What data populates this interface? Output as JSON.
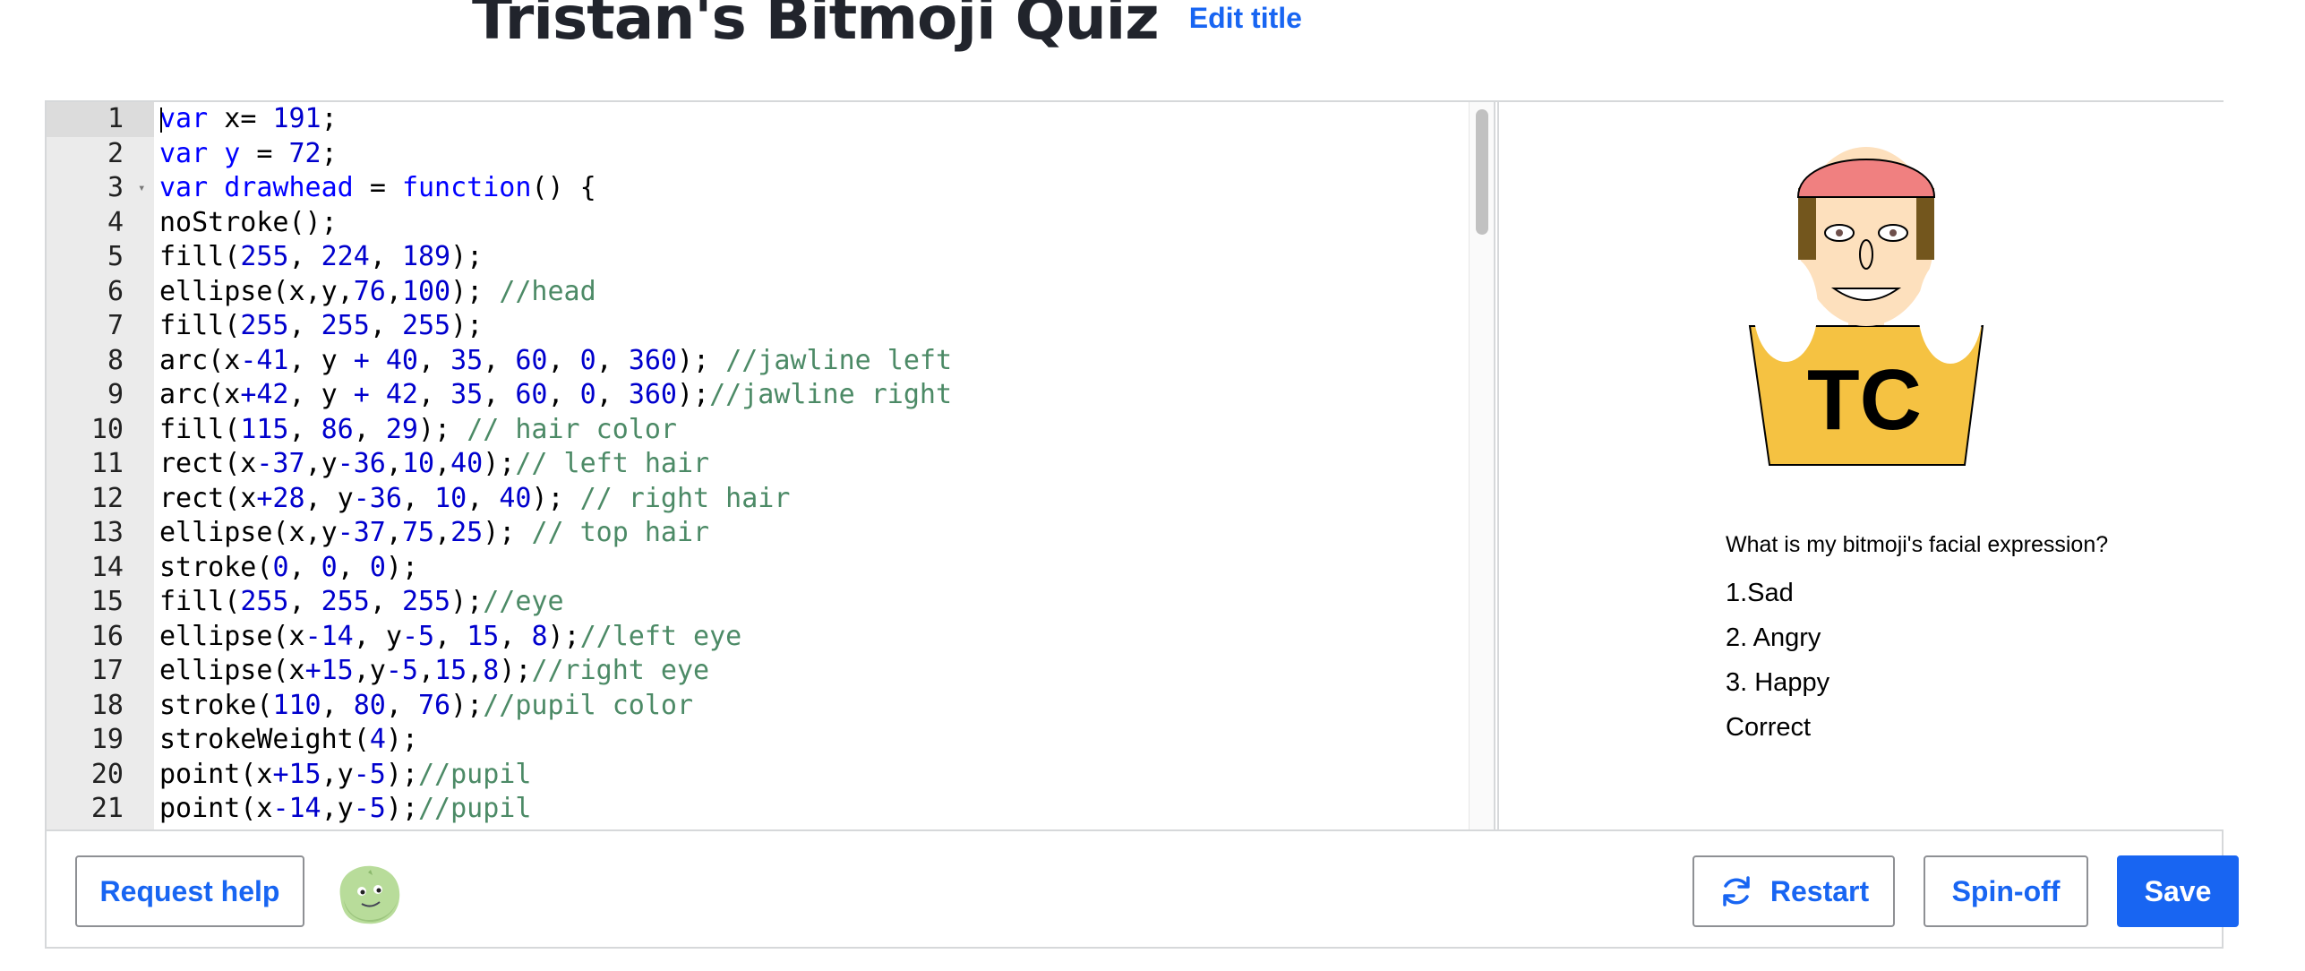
{
  "header": {
    "title": "Tristan's Bitmoji Quiz",
    "edit_title_label": "Edit title"
  },
  "editor": {
    "lines": [
      {
        "num": "1",
        "tokens": [
          {
            "t": "var",
            "c": "k"
          },
          {
            "t": " x",
            "c": "p"
          },
          {
            "t": "=",
            "c": "p"
          },
          {
            "t": " ",
            "c": "p"
          },
          {
            "t": "191",
            "c": "n"
          },
          {
            "t": ";",
            "c": "p"
          }
        ]
      },
      {
        "num": "2",
        "tokens": [
          {
            "t": "var",
            "c": "k"
          },
          {
            "t": " y ",
            "c": "k"
          },
          {
            "t": "=",
            "c": "p"
          },
          {
            "t": " ",
            "c": "p"
          },
          {
            "t": "72",
            "c": "n"
          },
          {
            "t": ";",
            "c": "p"
          }
        ]
      },
      {
        "num": "3",
        "tokens": [
          {
            "t": "var",
            "c": "k"
          },
          {
            "t": " drawhead ",
            "c": "k"
          },
          {
            "t": "=",
            "c": "p"
          },
          {
            "t": " ",
            "c": "p"
          },
          {
            "t": "function",
            "c": "k"
          },
          {
            "t": "() {",
            "c": "p"
          }
        ]
      },
      {
        "num": "4",
        "tokens": [
          {
            "t": "noStroke();",
            "c": "p"
          }
        ]
      },
      {
        "num": "5",
        "tokens": [
          {
            "t": "fill(",
            "c": "p"
          },
          {
            "t": "255",
            "c": "n"
          },
          {
            "t": ", ",
            "c": "p"
          },
          {
            "t": "224",
            "c": "n"
          },
          {
            "t": ", ",
            "c": "p"
          },
          {
            "t": "189",
            "c": "n"
          },
          {
            "t": ");",
            "c": "p"
          }
        ]
      },
      {
        "num": "6",
        "tokens": [
          {
            "t": "ellipse(x,y,",
            "c": "p"
          },
          {
            "t": "76",
            "c": "n"
          },
          {
            "t": ",",
            "c": "p"
          },
          {
            "t": "100",
            "c": "n"
          },
          {
            "t": "); ",
            "c": "p"
          },
          {
            "t": "//head",
            "c": "c"
          }
        ]
      },
      {
        "num": "7",
        "tokens": [
          {
            "t": "fill(",
            "c": "p"
          },
          {
            "t": "255",
            "c": "n"
          },
          {
            "t": ", ",
            "c": "p"
          },
          {
            "t": "255",
            "c": "n"
          },
          {
            "t": ", ",
            "c": "p"
          },
          {
            "t": "255",
            "c": "n"
          },
          {
            "t": ");",
            "c": "p"
          }
        ]
      },
      {
        "num": "8",
        "tokens": [
          {
            "t": "arc(x",
            "c": "p"
          },
          {
            "t": "-41",
            "c": "n"
          },
          {
            "t": ", y ",
            "c": "p"
          },
          {
            "t": "+",
            "c": "n"
          },
          {
            "t": " ",
            "c": "p"
          },
          {
            "t": "40",
            "c": "n"
          },
          {
            "t": ", ",
            "c": "p"
          },
          {
            "t": "35",
            "c": "n"
          },
          {
            "t": ", ",
            "c": "p"
          },
          {
            "t": "60",
            "c": "n"
          },
          {
            "t": ", ",
            "c": "p"
          },
          {
            "t": "0",
            "c": "n"
          },
          {
            "t": ", ",
            "c": "p"
          },
          {
            "t": "360",
            "c": "n"
          },
          {
            "t": "); ",
            "c": "p"
          },
          {
            "t": "//jawline left",
            "c": "c"
          }
        ]
      },
      {
        "num": "9",
        "tokens": [
          {
            "t": "arc(x",
            "c": "p"
          },
          {
            "t": "+42",
            "c": "n"
          },
          {
            "t": ", y ",
            "c": "p"
          },
          {
            "t": "+",
            "c": "n"
          },
          {
            "t": " ",
            "c": "p"
          },
          {
            "t": "42",
            "c": "n"
          },
          {
            "t": ", ",
            "c": "p"
          },
          {
            "t": "35",
            "c": "n"
          },
          {
            "t": ", ",
            "c": "p"
          },
          {
            "t": "60",
            "c": "n"
          },
          {
            "t": ", ",
            "c": "p"
          },
          {
            "t": "0",
            "c": "n"
          },
          {
            "t": ", ",
            "c": "p"
          },
          {
            "t": "360",
            "c": "n"
          },
          {
            "t": ");",
            "c": "p"
          },
          {
            "t": "//jawline right",
            "c": "c"
          }
        ]
      },
      {
        "num": "10",
        "tokens": [
          {
            "t": "fill(",
            "c": "p"
          },
          {
            "t": "115",
            "c": "n"
          },
          {
            "t": ", ",
            "c": "p"
          },
          {
            "t": "86",
            "c": "n"
          },
          {
            "t": ", ",
            "c": "p"
          },
          {
            "t": "29",
            "c": "n"
          },
          {
            "t": "); ",
            "c": "p"
          },
          {
            "t": "// hair color",
            "c": "c"
          }
        ]
      },
      {
        "num": "11",
        "tokens": [
          {
            "t": "rect(x",
            "c": "p"
          },
          {
            "t": "-37",
            "c": "n"
          },
          {
            "t": ",y",
            "c": "p"
          },
          {
            "t": "-36",
            "c": "n"
          },
          {
            "t": ",",
            "c": "p"
          },
          {
            "t": "10",
            "c": "n"
          },
          {
            "t": ",",
            "c": "p"
          },
          {
            "t": "40",
            "c": "n"
          },
          {
            "t": ");",
            "c": "p"
          },
          {
            "t": "// left hair",
            "c": "c"
          }
        ]
      },
      {
        "num": "12",
        "tokens": [
          {
            "t": "rect(x",
            "c": "p"
          },
          {
            "t": "+28",
            "c": "n"
          },
          {
            "t": ", y",
            "c": "p"
          },
          {
            "t": "-36",
            "c": "n"
          },
          {
            "t": ", ",
            "c": "p"
          },
          {
            "t": "10",
            "c": "n"
          },
          {
            "t": ", ",
            "c": "p"
          },
          {
            "t": "40",
            "c": "n"
          },
          {
            "t": "); ",
            "c": "p"
          },
          {
            "t": "// right hair",
            "c": "c"
          }
        ]
      },
      {
        "num": "13",
        "tokens": [
          {
            "t": "ellipse(x,y",
            "c": "p"
          },
          {
            "t": "-37",
            "c": "n"
          },
          {
            "t": ",",
            "c": "p"
          },
          {
            "t": "75",
            "c": "n"
          },
          {
            "t": ",",
            "c": "p"
          },
          {
            "t": "25",
            "c": "n"
          },
          {
            "t": "); ",
            "c": "p"
          },
          {
            "t": "// top hair",
            "c": "c"
          }
        ]
      },
      {
        "num": "14",
        "tokens": [
          {
            "t": "stroke(",
            "c": "p"
          },
          {
            "t": "0",
            "c": "n"
          },
          {
            "t": ", ",
            "c": "p"
          },
          {
            "t": "0",
            "c": "n"
          },
          {
            "t": ", ",
            "c": "p"
          },
          {
            "t": "0",
            "c": "n"
          },
          {
            "t": ");",
            "c": "p"
          }
        ]
      },
      {
        "num": "15",
        "tokens": [
          {
            "t": "fill(",
            "c": "p"
          },
          {
            "t": "255",
            "c": "n"
          },
          {
            "t": ", ",
            "c": "p"
          },
          {
            "t": "255",
            "c": "n"
          },
          {
            "t": ", ",
            "c": "p"
          },
          {
            "t": "255",
            "c": "n"
          },
          {
            "t": ");",
            "c": "p"
          },
          {
            "t": "//eye",
            "c": "c"
          }
        ]
      },
      {
        "num": "16",
        "tokens": [
          {
            "t": "ellipse(x",
            "c": "p"
          },
          {
            "t": "-14",
            "c": "n"
          },
          {
            "t": ", y",
            "c": "p"
          },
          {
            "t": "-5",
            "c": "n"
          },
          {
            "t": ", ",
            "c": "p"
          },
          {
            "t": "15",
            "c": "n"
          },
          {
            "t": ", ",
            "c": "p"
          },
          {
            "t": "8",
            "c": "n"
          },
          {
            "t": ");",
            "c": "p"
          },
          {
            "t": "//left eye",
            "c": "c"
          }
        ]
      },
      {
        "num": "17",
        "tokens": [
          {
            "t": "ellipse(x",
            "c": "p"
          },
          {
            "t": "+15",
            "c": "n"
          },
          {
            "t": ",y",
            "c": "p"
          },
          {
            "t": "-5",
            "c": "n"
          },
          {
            "t": ",",
            "c": "p"
          },
          {
            "t": "15",
            "c": "n"
          },
          {
            "t": ",",
            "c": "p"
          },
          {
            "t": "8",
            "c": "n"
          },
          {
            "t": ");",
            "c": "p"
          },
          {
            "t": "//right eye",
            "c": "c"
          }
        ]
      },
      {
        "num": "18",
        "tokens": [
          {
            "t": "stroke(",
            "c": "p"
          },
          {
            "t": "110",
            "c": "n"
          },
          {
            "t": ", ",
            "c": "p"
          },
          {
            "t": "80",
            "c": "n"
          },
          {
            "t": ", ",
            "c": "p"
          },
          {
            "t": "76",
            "c": "n"
          },
          {
            "t": ");",
            "c": "p"
          },
          {
            "t": "//pupil color",
            "c": "c"
          }
        ]
      },
      {
        "num": "19",
        "tokens": [
          {
            "t": "strokeWeight(",
            "c": "p"
          },
          {
            "t": "4",
            "c": "n"
          },
          {
            "t": ");",
            "c": "p"
          }
        ]
      },
      {
        "num": "20",
        "tokens": [
          {
            "t": "point(x",
            "c": "p"
          },
          {
            "t": "+15",
            "c": "n"
          },
          {
            "t": ",y",
            "c": "p"
          },
          {
            "t": "-5",
            "c": "n"
          },
          {
            "t": ");",
            "c": "p"
          },
          {
            "t": "//pupil",
            "c": "c"
          }
        ]
      },
      {
        "num": "21",
        "tokens": [
          {
            "t": "point(x",
            "c": "p"
          },
          {
            "t": "-14",
            "c": "n"
          },
          {
            "t": ",y",
            "c": "p"
          },
          {
            "t": "-5",
            "c": "n"
          },
          {
            "t": ");",
            "c": "p"
          },
          {
            "t": "//pupil",
            "c": "c"
          }
        ]
      }
    ]
  },
  "output": {
    "badge_text": "TC",
    "question": "What is my bitmoji's facial expression?",
    "options": [
      "1.Sad",
      "2. Angry",
      "3. Happy",
      "Correct"
    ],
    "colors": {
      "skin": "#fde0bd",
      "hair_brown": "#73561d",
      "hair_top": "#f08080",
      "shirt": "#f5c242"
    }
  },
  "toolbar": {
    "request_help_label": "Request help",
    "restart_label": "Restart",
    "spinoff_label": "Spin-off",
    "save_label": "Save",
    "avatar_icon": "green-blob-avatar-icon",
    "restart_icon": "refresh-icon"
  }
}
